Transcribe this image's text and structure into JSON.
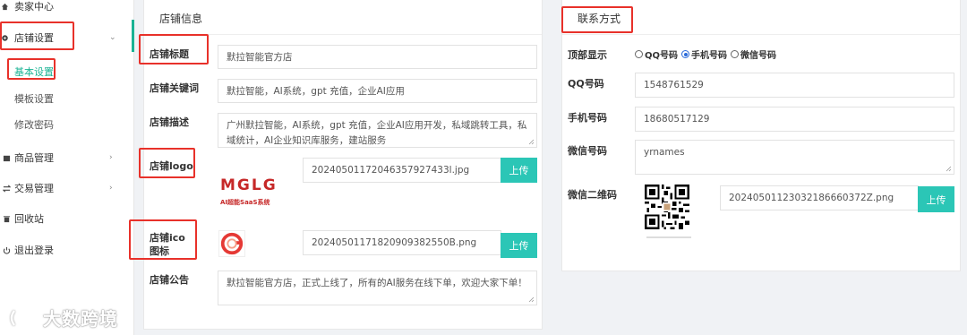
{
  "sidebar": {
    "seller_center": "卖家中心",
    "store_settings": "店铺设置",
    "sub_items": [
      "基本设置",
      "模板设置",
      "修改密码"
    ],
    "goods": "商品管理",
    "trade": "交易管理",
    "recycle": "回收站",
    "logout": "退出登录"
  },
  "store_info": {
    "title": "店铺信息",
    "store_title_label": "店铺标题",
    "store_title_value": "默拉智能官方店",
    "keywords_label": "店铺关键词",
    "keywords_value": "默拉智能，AI系统，gpt 充值，企业AI应用",
    "desc_label": "店铺描述",
    "desc_value": "广州默拉智能，AI系统，gpt 充值，企业AI应用开发，私域跳转工具，私域统计，AI企业知识库服务，建站服务",
    "logo_label": "店铺logo",
    "logo_file": "20240501172046357927433l.jpg",
    "logo_text": "MGLG",
    "logo_subtext": "AI超能SaaS系统",
    "ico_label": "店铺ico图标",
    "ico_file": "20240501171820909382550B.png",
    "notice_label": "店铺公告",
    "notice_value": "默拉智能官方店，正式上线了，所有的AI服务在线下单，欢迎大家下单！",
    "upload_label": "上传"
  },
  "contact": {
    "title": "联系方式",
    "top_display_label": "顶部显示",
    "options": [
      "QQ号码",
      "手机号码",
      "微信号码"
    ],
    "selected_option": "手机号码",
    "qq_label": "QQ号码",
    "qq_value": "1548761529",
    "phone_label": "手机号码",
    "phone_value": "18680517129",
    "wechat_label": "微信号码",
    "wechat_value": "yrnames",
    "qr_label": "微信二维码",
    "qr_file": "20240501123032186660372Z.png",
    "upload_label": "上传"
  },
  "watermark": "大数跨境",
  "colors": {
    "accent": "#2bc6b6",
    "highlight": "#e8312a",
    "active_menu": "#1ab394"
  }
}
